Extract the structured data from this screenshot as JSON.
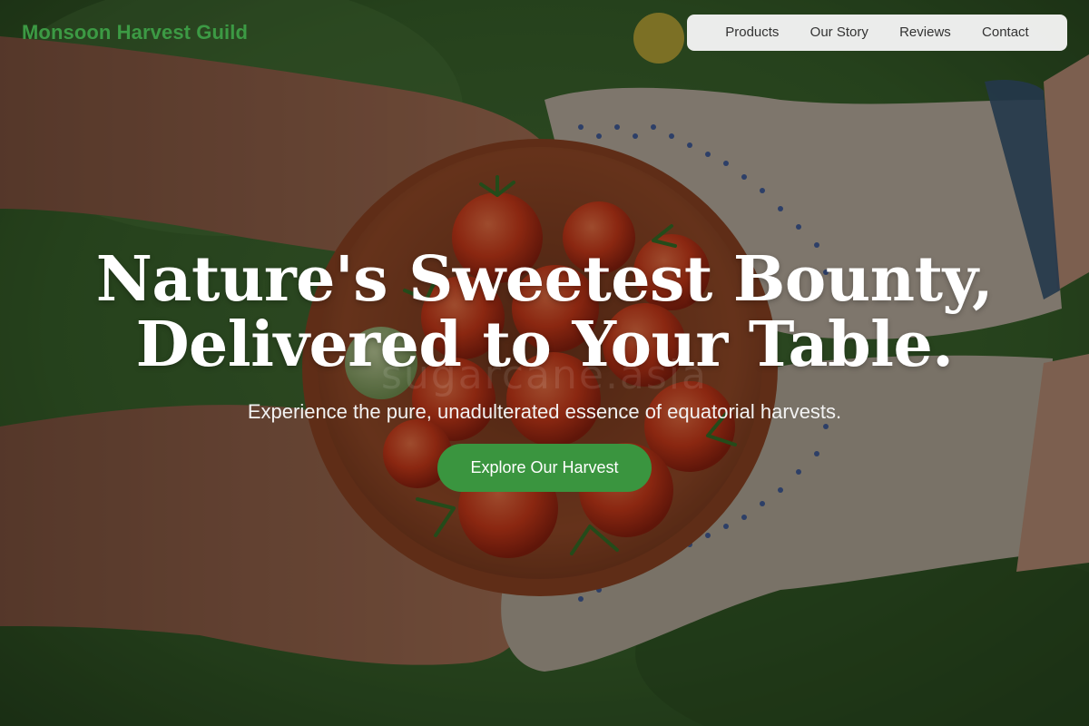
{
  "header": {
    "brand": "Monsoon Harvest Guild",
    "nav": [
      {
        "label": "Products"
      },
      {
        "label": "Our Story"
      },
      {
        "label": "Reviews"
      },
      {
        "label": "Contact"
      }
    ]
  },
  "hero": {
    "title_line1": "Nature's Sweetest Bounty,",
    "title_line2": "Delivered to Your Table.",
    "subtitle": "Experience the pure, unadulterated essence of equatorial harvests.",
    "cta_label": "Explore Our Harvest",
    "watermark": "sugarcane.asia",
    "background_image": "hands-exchanging-bowl-of-cherry-tomatoes-on-grass"
  },
  "colors": {
    "brand": "#3c9a44",
    "cta_background": "#3a953f",
    "nav_background": "#f4f4f4",
    "hero_text": "#ffffff"
  }
}
